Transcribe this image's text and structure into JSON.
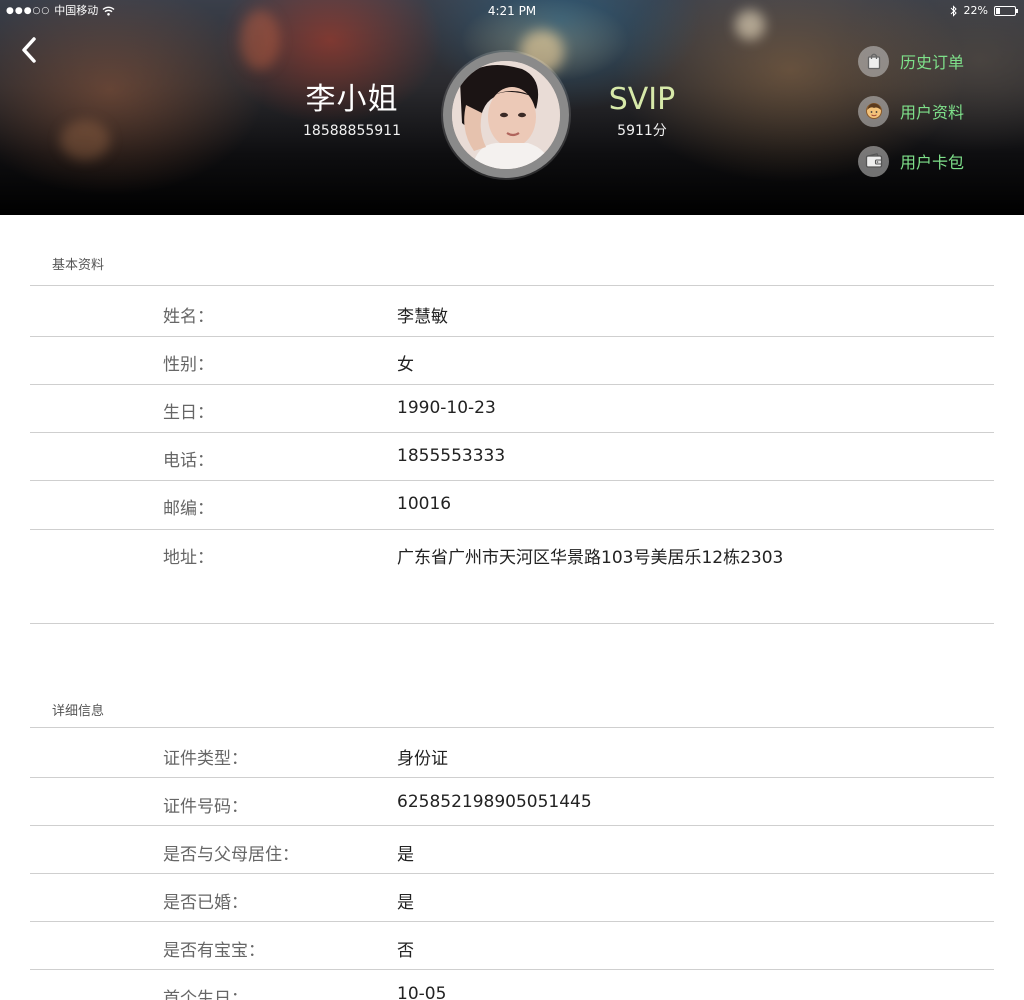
{
  "status_bar": {
    "carrier": "中国移动",
    "time": "4:21 PM",
    "battery_text": "22%",
    "battery_level": 0.22
  },
  "profile": {
    "name": "李小姐",
    "phone": "18588855911",
    "vip_level": "SVIP",
    "points": "5911分"
  },
  "side_menu": {
    "items": [
      {
        "label": "历史订单",
        "icon": "shopping-bag-icon"
      },
      {
        "label": "用户资料",
        "icon": "user-face-icon"
      },
      {
        "label": "用户卡包",
        "icon": "wallet-icon"
      }
    ]
  },
  "basic": {
    "title": "基本资料",
    "rows": [
      {
        "label": "姓名：",
        "value": "李慧敏"
      },
      {
        "label": "性别：",
        "value": "女"
      },
      {
        "label": "生日：",
        "value": "1990-10-23"
      },
      {
        "label": "电话：",
        "value": "1855553333"
      },
      {
        "label": "邮编：",
        "value": "10016"
      },
      {
        "label": "地址：",
        "value": "广东省广州市天河区华景路103号美居乐12栋2303"
      }
    ]
  },
  "detail": {
    "title": "详细信息",
    "rows": [
      {
        "label": "证件类型：",
        "value": "身份证"
      },
      {
        "label": "证件号码：",
        "value": "625852198905051445"
      },
      {
        "label": "是否与父母居住：",
        "value": "是"
      },
      {
        "label": "是否已婚：",
        "value": "是"
      },
      {
        "label": "是否有宝宝：",
        "value": "否"
      },
      {
        "label": "首个生日：",
        "value": "10-05"
      }
    ]
  },
  "colors": {
    "menu_text": "#7ee08a",
    "vip_text": "#d7e9a9"
  }
}
